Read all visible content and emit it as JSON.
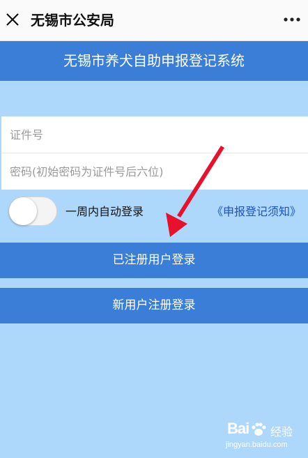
{
  "topbar": {
    "title": "无锡市公安局",
    "close_icon": "close-icon",
    "more_icon": "more-dots-icon"
  },
  "banner": {
    "title": "无锡市养犬自助申报登记系统"
  },
  "form": {
    "id_placeholder": "证件号",
    "password_placeholder": "密码(初始密码为证件号后六位)"
  },
  "auto_login": {
    "label": "一周内自动登录",
    "enabled": false
  },
  "notice_link": "《申报登记须知》",
  "buttons": {
    "login": "已注册用户登录",
    "register": "新用户注册登录"
  },
  "annotation": {
    "arrow_color": "#e8102a"
  },
  "watermark": {
    "brand": "Bai",
    "brand_suffix": "经验",
    "url": "jingyan.baidu.com"
  },
  "colors": {
    "background": "#aed8fb",
    "primary": "#3a7ed8",
    "link": "#1a4fd6"
  }
}
